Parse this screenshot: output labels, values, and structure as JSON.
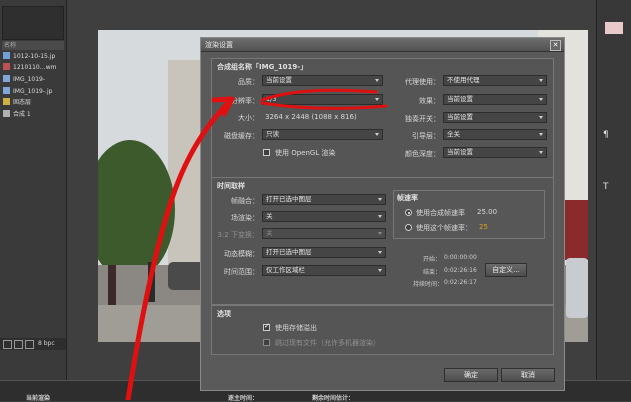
{
  "left_panel": {
    "header": "名称",
    "items": [
      {
        "label": "1012-10-15.jp",
        "color": "#6fa0d8"
      },
      {
        "label": "1210110…wm",
        "color": "#c05050"
      },
      {
        "label": "IMG_1019-",
        "color": "#7fa8d8"
      },
      {
        "label": "IMG_1019-.jp",
        "color": "#7fa8d8"
      },
      {
        "label": "固态层",
        "color": "#d0b040"
      },
      {
        "label": "合成 1",
        "color": "#b0b0b0"
      }
    ],
    "bpc": "8 bpc"
  },
  "bottom": {
    "left": "当前渲染",
    "mid": "逐主时间：",
    "right": "剩余时间估计："
  },
  "dialog": {
    "title": "渲染设置",
    "composition_name": "合成组名称「IMG_1019-」",
    "quality": {
      "label": "品质：",
      "value": "当前设置"
    },
    "resolution": {
      "label": "分辨率：",
      "value": "1/3"
    },
    "size": {
      "label": "大小：",
      "value": "3264 x 2448 (1088 x 816)"
    },
    "disk_cache": {
      "label": "磁盘缓存：",
      "value": "只读"
    },
    "opengl": {
      "label": "使用 OpenGL 渲染",
      "checked": false
    },
    "proxy_use": {
      "label": "代理使用：",
      "value": "不使用代理"
    },
    "effects": {
      "label": "效果：",
      "value": "当前设置"
    },
    "solo_switches": {
      "label": "独奏开关：",
      "value": "当前设置"
    },
    "guide_layers": {
      "label": "引导层：",
      "value": "全关"
    },
    "color_depth": {
      "label": "颜色深度：",
      "value": "当前设置"
    },
    "time_sampling": {
      "title": "时间取样",
      "frame_blending": {
        "label": "帧融合：",
        "value": "打开已选中图层"
      },
      "field_render": {
        "label": "场渲染：",
        "value": "关"
      },
      "pulldown": {
        "label": "3:2 下变换：",
        "value": "关"
      },
      "motion_blur": {
        "label": "动态模糊：",
        "value": "打开已选中图层"
      },
      "time_span": {
        "label": "时间范围：",
        "value": "仅工作区域栏"
      }
    },
    "frame_rate": {
      "title": "帧速率",
      "use_comp": {
        "label": "使用合成帧速率",
        "value": "25.00",
        "selected": true
      },
      "use_this": {
        "label": "使用这个帧速率：",
        "value": "25",
        "selected": false
      }
    },
    "timing": {
      "start_label": "开始：",
      "start_value": "0:00:00:00",
      "end_label": "结束：",
      "end_value": "0:02:26:16",
      "duration_label": "持续时间：",
      "duration_value": "0:02:26:17",
      "custom_button": "自定义..."
    },
    "options": {
      "title": "选项",
      "use_storage_overflow": {
        "label": "使用存储溢出",
        "checked": true
      },
      "skip_existing": {
        "label": "跳过现有文件（允许多机器渲染）",
        "checked": false
      }
    },
    "ok_button": "确定",
    "cancel_button": "取消"
  },
  "colors": {
    "annotation_red": "#e01010",
    "dialog_bg": "#5a5a5a",
    "accent_orange": "#e0a020"
  }
}
